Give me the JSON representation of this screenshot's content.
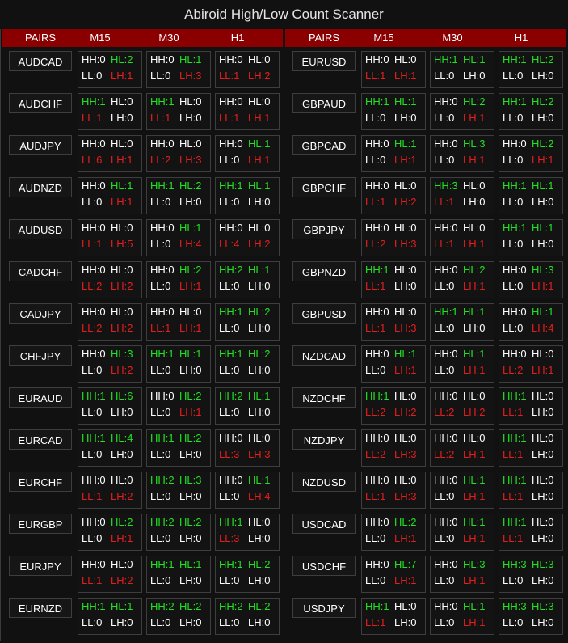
{
  "title": "Abiroid High/Low Count Scanner",
  "headers": {
    "pairs": "PAIRS",
    "tf1": "M15",
    "tf2": "M30",
    "tf3": "H1"
  },
  "colors": {
    "header_bg": "#8a0000",
    "positive": "#22e022",
    "negative": "#e41e1e",
    "neutral": "#ffffff"
  },
  "left": [
    {
      "pair": "AUDCAD",
      "c": [
        [
          "HH:0",
          "HL:2",
          "LL:0",
          "LH:1"
        ],
        [
          "HH:0",
          "HL:1",
          "LL:0",
          "LH:3"
        ],
        [
          "HH:0",
          "HL:0",
          "LL:1",
          "LH:2"
        ]
      ]
    },
    {
      "pair": "AUDCHF",
      "c": [
        [
          "HH:1",
          "HL:0",
          "LL:1",
          "LH:0"
        ],
        [
          "HH:1",
          "HL:0",
          "LL:1",
          "LH:0"
        ],
        [
          "HH:0",
          "HL:0",
          "LL:1",
          "LH:1"
        ]
      ]
    },
    {
      "pair": "AUDJPY",
      "c": [
        [
          "HH:0",
          "HL:0",
          "LL:6",
          "LH:1"
        ],
        [
          "HH:0",
          "HL:0",
          "LL:2",
          "LH:3"
        ],
        [
          "HH:0",
          "HL:1",
          "LL:0",
          "LH:1"
        ]
      ]
    },
    {
      "pair": "AUDNZD",
      "c": [
        [
          "HH:0",
          "HL:1",
          "LL:0",
          "LH:1"
        ],
        [
          "HH:1",
          "HL:2",
          "LL:0",
          "LH:0"
        ],
        [
          "HH:1",
          "HL:1",
          "LL:0",
          "LH:0"
        ]
      ]
    },
    {
      "pair": "AUDUSD",
      "c": [
        [
          "HH:0",
          "HL:0",
          "LL:1",
          "LH:5"
        ],
        [
          "HH:0",
          "HL:1",
          "LL:0",
          "LH:4"
        ],
        [
          "HH:0",
          "HL:0",
          "LL:4",
          "LH:2"
        ]
      ]
    },
    {
      "pair": "CADCHF",
      "c": [
        [
          "HH:0",
          "HL:0",
          "LL:2",
          "LH:2"
        ],
        [
          "HH:0",
          "HL:2",
          "LL:0",
          "LH:1"
        ],
        [
          "HH:2",
          "HL:1",
          "LL:0",
          "LH:0"
        ]
      ]
    },
    {
      "pair": "CADJPY",
      "c": [
        [
          "HH:0",
          "HL:0",
          "LL:2",
          "LH:2"
        ],
        [
          "HH:0",
          "HL:0",
          "LL:1",
          "LH:1"
        ],
        [
          "HH:1",
          "HL:2",
          "LL:0",
          "LH:0"
        ]
      ]
    },
    {
      "pair": "CHFJPY",
      "c": [
        [
          "HH:0",
          "HL:3",
          "LL:0",
          "LH:2"
        ],
        [
          "HH:1",
          "HL:1",
          "LL:0",
          "LH:0"
        ],
        [
          "HH:1",
          "HL:2",
          "LL:0",
          "LH:0"
        ]
      ]
    },
    {
      "pair": "EURAUD",
      "c": [
        [
          "HH:1",
          "HL:6",
          "LL:0",
          "LH:0"
        ],
        [
          "HH:0",
          "HL:2",
          "LL:0",
          "LH:1"
        ],
        [
          "HH:2",
          "HL:1",
          "LL:0",
          "LH:0"
        ]
      ]
    },
    {
      "pair": "EURCAD",
      "c": [
        [
          "HH:1",
          "HL:4",
          "LL:0",
          "LH:0"
        ],
        [
          "HH:1",
          "HL:2",
          "LL:0",
          "LH:0"
        ],
        [
          "HH:0",
          "HL:0",
          "LL:3",
          "LH:3"
        ]
      ]
    },
    {
      "pair": "EURCHF",
      "c": [
        [
          "HH:0",
          "HL:0",
          "LL:1",
          "LH:2"
        ],
        [
          "HH:2",
          "HL:3",
          "LL:0",
          "LH:0"
        ],
        [
          "HH:0",
          "HL:1",
          "LL:0",
          "LH:4"
        ]
      ]
    },
    {
      "pair": "EURGBP",
      "c": [
        [
          "HH:0",
          "HL:2",
          "LL:0",
          "LH:1"
        ],
        [
          "HH:2",
          "HL:2",
          "LL:0",
          "LH:0"
        ],
        [
          "HH:1",
          "HL:0",
          "LL:3",
          "LH:0"
        ]
      ]
    },
    {
      "pair": "EURJPY",
      "c": [
        [
          "HH:0",
          "HL:0",
          "LL:1",
          "LH:2"
        ],
        [
          "HH:1",
          "HL:1",
          "LL:0",
          "LH:0"
        ],
        [
          "HH:1",
          "HL:2",
          "LL:0",
          "LH:0"
        ]
      ]
    },
    {
      "pair": "EURNZD",
      "c": [
        [
          "HH:1",
          "HL:1",
          "LL:0",
          "LH:0"
        ],
        [
          "HH:2",
          "HL:2",
          "LL:0",
          "LH:0"
        ],
        [
          "HH:2",
          "HL:2",
          "LL:0",
          "LH:0"
        ]
      ]
    }
  ],
  "right": [
    {
      "pair": "EURUSD",
      "c": [
        [
          "HH:0",
          "HL:0",
          "LL:1",
          "LH:1"
        ],
        [
          "HH:1",
          "HL:1",
          "LL:0",
          "LH:0"
        ],
        [
          "HH:1",
          "HL:2",
          "LL:0",
          "LH:0"
        ]
      ]
    },
    {
      "pair": "GBPAUD",
      "c": [
        [
          "HH:1",
          "HL:1",
          "LL:0",
          "LH:0"
        ],
        [
          "HH:0",
          "HL:2",
          "LL:0",
          "LH:1"
        ],
        [
          "HH:1",
          "HL:2",
          "LL:0",
          "LH:0"
        ]
      ]
    },
    {
      "pair": "GBPCAD",
      "c": [
        [
          "HH:0",
          "HL:1",
          "LL:0",
          "LH:1"
        ],
        [
          "HH:0",
          "HL:3",
          "LL:0",
          "LH:1"
        ],
        [
          "HH:0",
          "HL:2",
          "LL:0",
          "LH:1"
        ]
      ]
    },
    {
      "pair": "GBPCHF",
      "c": [
        [
          "HH:0",
          "HL:0",
          "LL:1",
          "LH:2"
        ],
        [
          "HH:3",
          "HL:0",
          "LL:1",
          "LH:0"
        ],
        [
          "HH:1",
          "HL:1",
          "LL:0",
          "LH:0"
        ]
      ]
    },
    {
      "pair": "GBPJPY",
      "c": [
        [
          "HH:0",
          "HL:0",
          "LL:2",
          "LH:3"
        ],
        [
          "HH:0",
          "HL:0",
          "LL:1",
          "LH:1"
        ],
        [
          "HH:1",
          "HL:1",
          "LL:0",
          "LH:0"
        ]
      ]
    },
    {
      "pair": "GBPNZD",
      "c": [
        [
          "HH:1",
          "HL:0",
          "LL:1",
          "LH:0"
        ],
        [
          "HH:0",
          "HL:2",
          "LL:0",
          "LH:1"
        ],
        [
          "HH:0",
          "HL:3",
          "LL:0",
          "LH:1"
        ]
      ]
    },
    {
      "pair": "GBPUSD",
      "c": [
        [
          "HH:0",
          "HL:0",
          "LL:1",
          "LH:3"
        ],
        [
          "HH:1",
          "HL:1",
          "LL:0",
          "LH:0"
        ],
        [
          "HH:0",
          "HL:1",
          "LL:0",
          "LH:4"
        ]
      ]
    },
    {
      "pair": "NZDCAD",
      "c": [
        [
          "HH:0",
          "HL:1",
          "LL:0",
          "LH:1"
        ],
        [
          "HH:0",
          "HL:1",
          "LL:0",
          "LH:1"
        ],
        [
          "HH:0",
          "HL:0",
          "LL:2",
          "LH:1"
        ]
      ]
    },
    {
      "pair": "NZDCHF",
      "c": [
        [
          "HH:1",
          "HL:0",
          "LL:2",
          "LH:2"
        ],
        [
          "HH:0",
          "HL:0",
          "LL:2",
          "LH:2"
        ],
        [
          "HH:1",
          "HL:0",
          "LL:1",
          "LH:0"
        ]
      ]
    },
    {
      "pair": "NZDJPY",
      "c": [
        [
          "HH:0",
          "HL:0",
          "LL:2",
          "LH:3"
        ],
        [
          "HH:0",
          "HL:0",
          "LL:2",
          "LH:1"
        ],
        [
          "HH:1",
          "HL:0",
          "LL:1",
          "LH:0"
        ]
      ]
    },
    {
      "pair": "NZDUSD",
      "c": [
        [
          "HH:0",
          "HL:0",
          "LL:1",
          "LH:3"
        ],
        [
          "HH:0",
          "HL:1",
          "LL:0",
          "LH:1"
        ],
        [
          "HH:1",
          "HL:0",
          "LL:1",
          "LH:0"
        ]
      ]
    },
    {
      "pair": "USDCAD",
      "c": [
        [
          "HH:0",
          "HL:2",
          "LL:0",
          "LH:1"
        ],
        [
          "HH:0",
          "HL:1",
          "LL:0",
          "LH:1"
        ],
        [
          "HH:1",
          "HL:0",
          "LL:1",
          "LH:0"
        ]
      ]
    },
    {
      "pair": "USDCHF",
      "c": [
        [
          "HH:0",
          "HL:7",
          "LL:0",
          "LH:1"
        ],
        [
          "HH:0",
          "HL:3",
          "LL:0",
          "LH:1"
        ],
        [
          "HH:3",
          "HL:3",
          "LL:0",
          "LH:0"
        ]
      ]
    },
    {
      "pair": "USDJPY",
      "c": [
        [
          "HH:1",
          "HL:0",
          "LL:1",
          "LH:0"
        ],
        [
          "HH:0",
          "HL:1",
          "LL:0",
          "LH:1"
        ],
        [
          "HH:3",
          "HL:3",
          "LL:0",
          "LH:0"
        ]
      ]
    }
  ]
}
